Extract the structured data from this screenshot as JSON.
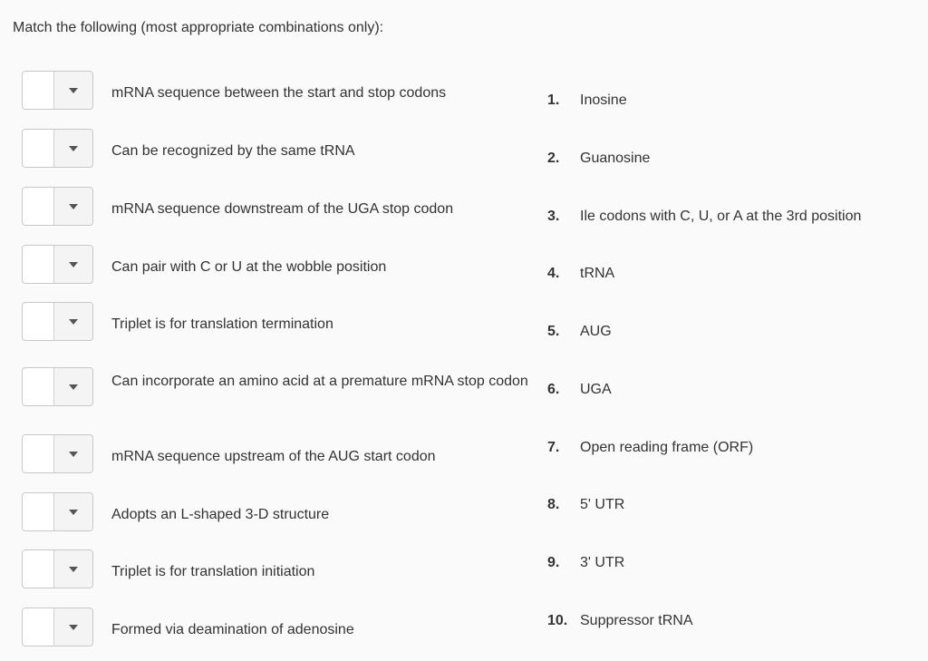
{
  "instructions": "Match the following (most appropriate combinations only):",
  "prompts": [
    {
      "text": "mRNA sequence between the start and stop codons",
      "selected": ""
    },
    {
      "text": "Can be recognized by the same tRNA",
      "selected": ""
    },
    {
      "text": "mRNA sequence downstream of the UGA stop codon",
      "selected": ""
    },
    {
      "text": "Can pair with C or U at the wobble position",
      "selected": ""
    },
    {
      "text": "Triplet is for translation termination",
      "selected": ""
    },
    {
      "text": "Can incorporate an amino acid at a premature mRNA stop codon",
      "selected": ""
    },
    {
      "text": "mRNA sequence upstream of the AUG start codon",
      "selected": ""
    },
    {
      "text": "Adopts an L-shaped 3-D structure",
      "selected": ""
    },
    {
      "text": "Triplet is for translation initiation",
      "selected": ""
    },
    {
      "text": "Formed via deamination of adenosine",
      "selected": ""
    }
  ],
  "answers": [
    {
      "num": "1.",
      "text": "Inosine"
    },
    {
      "num": "2.",
      "text": "Guanosine"
    },
    {
      "num": "3.",
      "text": "Ile codons with C, U, or A at the 3rd position"
    },
    {
      "num": "4.",
      "text": "tRNA"
    },
    {
      "num": "5.",
      "text": "AUG"
    },
    {
      "num": "6.",
      "text": "UGA"
    },
    {
      "num": "7.",
      "text": "Open reading frame (ORF)"
    },
    {
      "num": "8.",
      "text": "5' UTR"
    },
    {
      "num": "9.",
      "text": "3' UTR"
    },
    {
      "num": "10.",
      "text": "Suppressor tRNA"
    }
  ]
}
